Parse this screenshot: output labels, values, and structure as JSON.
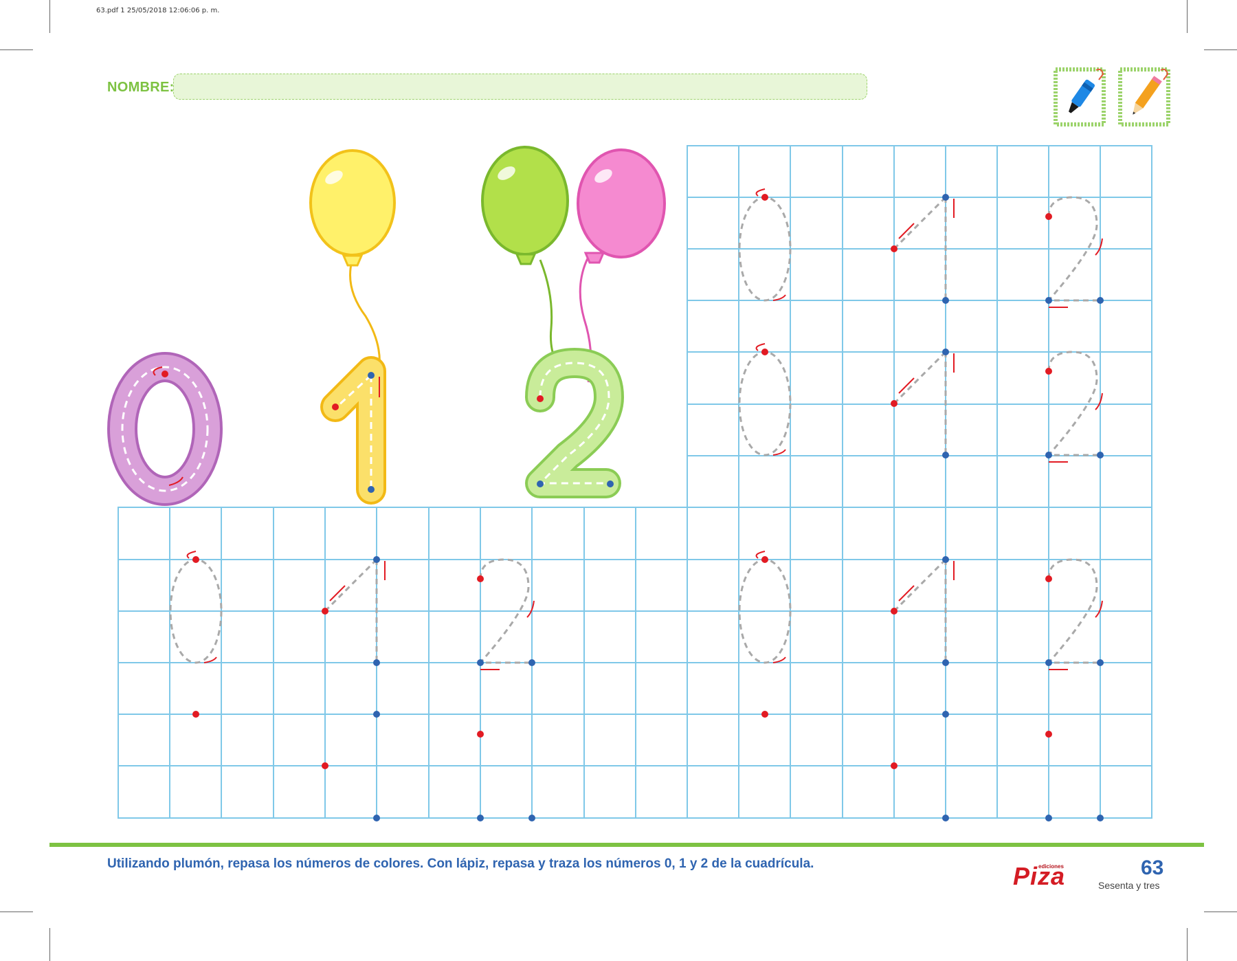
{
  "header": {
    "pdf_info": "63.pdf   1   25/05/2018   12:06:06 p. m.",
    "name_label": "NOMBRE:"
  },
  "tools": [
    {
      "icon": "marker-icon",
      "color": "#1e88e5"
    },
    {
      "icon": "pencil-icon",
      "color": "#f4a11e"
    }
  ],
  "big_numbers": [
    {
      "digit": "0",
      "color": "#d9a0d9",
      "stroke": "#b065b8"
    },
    {
      "digit": "1",
      "color": "#fbe06a",
      "stroke": "#f2b915"
    },
    {
      "digit": "2",
      "color": "#c9ec9a",
      "stroke": "#8bcc55"
    }
  ],
  "balloons": [
    {
      "color": "#fff16a",
      "stroke": "#f2c21a"
    },
    {
      "color": "#b2e04a",
      "stroke": "#7ab82d"
    },
    {
      "color": "#f58ad0",
      "stroke": "#e055b0"
    }
  ],
  "footer": {
    "instruction": "Utilizando plumón, repasa los números de colores. Con lápiz, repasa y traza los números 0, 1 y 2 de la cuadrícula.",
    "publisher_small": "ediciones",
    "publisher": "Piza",
    "page_number": "63",
    "page_word": "Sesenta y tres"
  }
}
